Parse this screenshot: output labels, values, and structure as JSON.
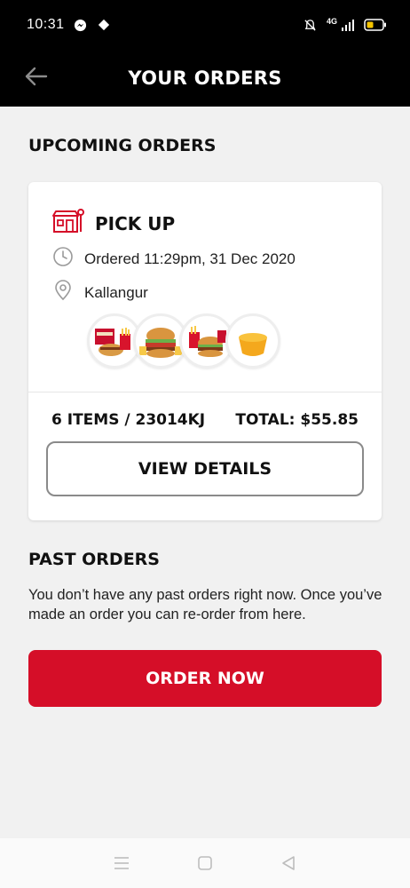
{
  "status_bar": {
    "time": "10:31",
    "network": "4G",
    "icons": [
      "messenger-icon",
      "signal-app-icon",
      "mute-icon",
      "signal-icon",
      "battery-icon"
    ]
  },
  "header": {
    "title": "YOUR ORDERS",
    "back_icon": "arrow-left-icon"
  },
  "upcoming": {
    "heading": "UPCOMING ORDERS",
    "card": {
      "type_label": "PICK UP",
      "type_icon": "store-icon",
      "ordered": "Ordered 11:29pm, 31 Dec 2020",
      "location": "Kallangur",
      "items_summary": "6 ITEMS / 23014KJ",
      "total": "TOTAL: $55.85",
      "button_label": "VIEW DETAILS",
      "thumbnails": [
        "meal-thumbnail-1",
        "burger-thumbnail",
        "meal-thumbnail-2",
        "sauce-thumbnail"
      ]
    }
  },
  "past": {
    "heading": "PAST ORDERS",
    "message": "You don’t have any past orders right now. Once you’ve made an order you can re-order from here.",
    "button_label": "ORDER NOW"
  },
  "colors": {
    "header_bg": "#000000",
    "brand_red": "#d50e28",
    "page_bg": "#f1f1f1"
  },
  "nav_bar": {
    "icons": [
      "menu-icon",
      "home-square-icon",
      "back-triangle-icon"
    ]
  }
}
